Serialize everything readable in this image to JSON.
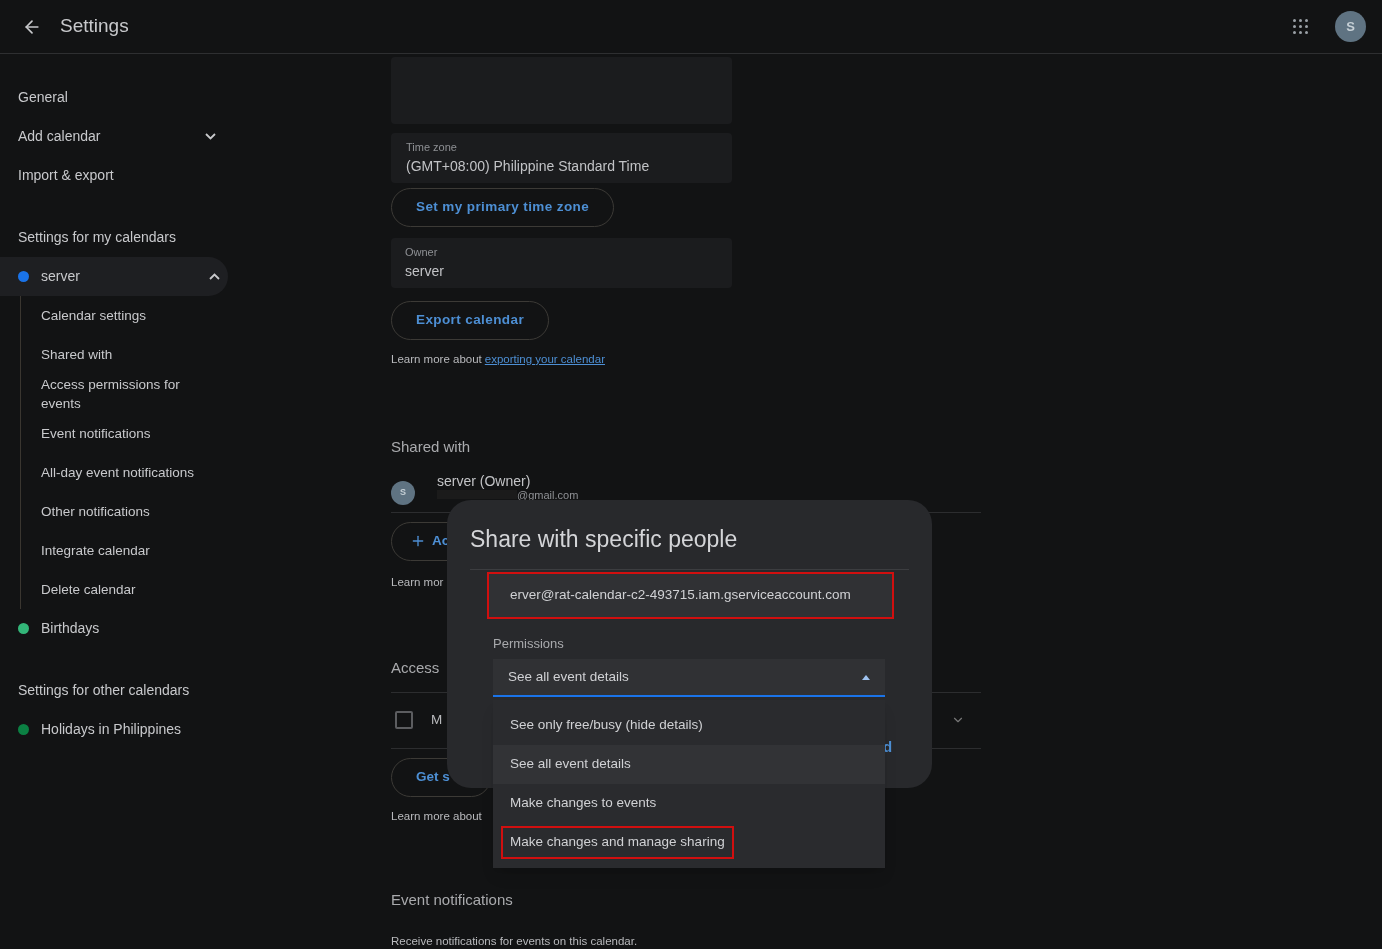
{
  "header": {
    "title": "Settings",
    "avatar": "S"
  },
  "sidebar": {
    "items": [
      {
        "label": "General",
        "expandable": false
      },
      {
        "label": "Add calendar",
        "expandable": true
      },
      {
        "label": "Import & export",
        "expandable": false
      }
    ],
    "sections": [
      {
        "title": "Settings for my calendars",
        "calendars": [
          {
            "name": "server",
            "color": "#1a73e8",
            "expanded": true,
            "selected": true,
            "children": [
              {
                "label": "Calendar settings"
              },
              {
                "label": "Shared with"
              },
              {
                "label": "Access permissions for events"
              },
              {
                "label": "Event notifications"
              },
              {
                "label": "All-day event notifications"
              },
              {
                "label": "Other notifications"
              },
              {
                "label": "Integrate calendar"
              },
              {
                "label": "Delete calendar"
              }
            ]
          },
          {
            "name": "Birthdays",
            "color": "#33b679",
            "selected": false
          }
        ]
      },
      {
        "title": "Settings for other calendars",
        "calendars": [
          {
            "name": "Holidays in Philippines",
            "color": "#0b8043",
            "selected": false
          }
        ]
      }
    ]
  },
  "main": {
    "time_zone": {
      "label": "Time zone",
      "value": "(GMT+08:00) Philippine Standard Time"
    },
    "primary_tz_button": "Set my primary time zone",
    "owner": {
      "label": "Owner",
      "value": "server"
    },
    "export_button": "Export calendar",
    "export_note": {
      "text": "Learn more about",
      "link": "exporting your calendar"
    },
    "shared_with": {
      "heading": "Shared with",
      "person": {
        "name": "server (Owner)",
        "email": "@gmail.com",
        "avatar": "S"
      },
      "add_button": "Ac",
      "note": "Learn mor"
    },
    "access": {
      "heading": "Access",
      "checkbox_label": "M",
      "checked": false,
      "button": "Get s",
      "note": "Learn more about"
    },
    "event_notifications": {
      "heading": "Event notifications",
      "note": "Receive notifications for events on this calendar."
    }
  },
  "dialog": {
    "title": "Share with specific people",
    "email": {
      "value": "erver@rat-calendar-c2-493715.iam.gserviceaccount.com",
      "highlighted": true
    },
    "permissions_label": "Permissions",
    "select_value": "See all event details",
    "open": true,
    "options": [
      {
        "label": "See only free/busy (hide details)",
        "selected": false,
        "highlighted": false
      },
      {
        "label": "See all event details",
        "selected": true,
        "highlighted": false
      },
      {
        "label": "Make changes to events",
        "selected": false,
        "highlighted": false
      },
      {
        "label": "Make changes and manage sharing",
        "selected": false,
        "highlighted": true
      }
    ],
    "button_fragment": "d"
  }
}
